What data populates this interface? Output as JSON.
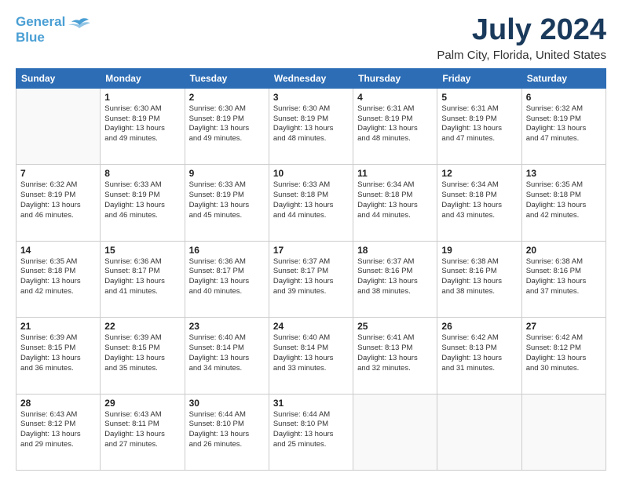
{
  "header": {
    "logo_general": "General",
    "logo_blue": "Blue",
    "main_title": "July 2024",
    "subtitle": "Palm City, Florida, United States"
  },
  "days_of_week": [
    "Sunday",
    "Monday",
    "Tuesday",
    "Wednesday",
    "Thursday",
    "Friday",
    "Saturday"
  ],
  "weeks": [
    [
      {
        "day": "",
        "sunrise": "",
        "sunset": "",
        "daylight": ""
      },
      {
        "day": "1",
        "sunrise": "6:30 AM",
        "sunset": "8:19 PM",
        "daylight": "13 hours and 49 minutes."
      },
      {
        "day": "2",
        "sunrise": "6:30 AM",
        "sunset": "8:19 PM",
        "daylight": "13 hours and 49 minutes."
      },
      {
        "day": "3",
        "sunrise": "6:30 AM",
        "sunset": "8:19 PM",
        "daylight": "13 hours and 48 minutes."
      },
      {
        "day": "4",
        "sunrise": "6:31 AM",
        "sunset": "8:19 PM",
        "daylight": "13 hours and 48 minutes."
      },
      {
        "day": "5",
        "sunrise": "6:31 AM",
        "sunset": "8:19 PM",
        "daylight": "13 hours and 47 minutes."
      },
      {
        "day": "6",
        "sunrise": "6:32 AM",
        "sunset": "8:19 PM",
        "daylight": "13 hours and 47 minutes."
      }
    ],
    [
      {
        "day": "7",
        "sunrise": "6:32 AM",
        "sunset": "8:19 PM",
        "daylight": "13 hours and 46 minutes."
      },
      {
        "day": "8",
        "sunrise": "6:33 AM",
        "sunset": "8:19 PM",
        "daylight": "13 hours and 46 minutes."
      },
      {
        "day": "9",
        "sunrise": "6:33 AM",
        "sunset": "8:19 PM",
        "daylight": "13 hours and 45 minutes."
      },
      {
        "day": "10",
        "sunrise": "6:33 AM",
        "sunset": "8:18 PM",
        "daylight": "13 hours and 44 minutes."
      },
      {
        "day": "11",
        "sunrise": "6:34 AM",
        "sunset": "8:18 PM",
        "daylight": "13 hours and 44 minutes."
      },
      {
        "day": "12",
        "sunrise": "6:34 AM",
        "sunset": "8:18 PM",
        "daylight": "13 hours and 43 minutes."
      },
      {
        "day": "13",
        "sunrise": "6:35 AM",
        "sunset": "8:18 PM",
        "daylight": "13 hours and 42 minutes."
      }
    ],
    [
      {
        "day": "14",
        "sunrise": "6:35 AM",
        "sunset": "8:18 PM",
        "daylight": "13 hours and 42 minutes."
      },
      {
        "day": "15",
        "sunrise": "6:36 AM",
        "sunset": "8:17 PM",
        "daylight": "13 hours and 41 minutes."
      },
      {
        "day": "16",
        "sunrise": "6:36 AM",
        "sunset": "8:17 PM",
        "daylight": "13 hours and 40 minutes."
      },
      {
        "day": "17",
        "sunrise": "6:37 AM",
        "sunset": "8:17 PM",
        "daylight": "13 hours and 39 minutes."
      },
      {
        "day": "18",
        "sunrise": "6:37 AM",
        "sunset": "8:16 PM",
        "daylight": "13 hours and 38 minutes."
      },
      {
        "day": "19",
        "sunrise": "6:38 AM",
        "sunset": "8:16 PM",
        "daylight": "13 hours and 38 minutes."
      },
      {
        "day": "20",
        "sunrise": "6:38 AM",
        "sunset": "8:16 PM",
        "daylight": "13 hours and 37 minutes."
      }
    ],
    [
      {
        "day": "21",
        "sunrise": "6:39 AM",
        "sunset": "8:15 PM",
        "daylight": "13 hours and 36 minutes."
      },
      {
        "day": "22",
        "sunrise": "6:39 AM",
        "sunset": "8:15 PM",
        "daylight": "13 hours and 35 minutes."
      },
      {
        "day": "23",
        "sunrise": "6:40 AM",
        "sunset": "8:14 PM",
        "daylight": "13 hours and 34 minutes."
      },
      {
        "day": "24",
        "sunrise": "6:40 AM",
        "sunset": "8:14 PM",
        "daylight": "13 hours and 33 minutes."
      },
      {
        "day": "25",
        "sunrise": "6:41 AM",
        "sunset": "8:13 PM",
        "daylight": "13 hours and 32 minutes."
      },
      {
        "day": "26",
        "sunrise": "6:42 AM",
        "sunset": "8:13 PM",
        "daylight": "13 hours and 31 minutes."
      },
      {
        "day": "27",
        "sunrise": "6:42 AM",
        "sunset": "8:12 PM",
        "daylight": "13 hours and 30 minutes."
      }
    ],
    [
      {
        "day": "28",
        "sunrise": "6:43 AM",
        "sunset": "8:12 PM",
        "daylight": "13 hours and 29 minutes."
      },
      {
        "day": "29",
        "sunrise": "6:43 AM",
        "sunset": "8:11 PM",
        "daylight": "13 hours and 27 minutes."
      },
      {
        "day": "30",
        "sunrise": "6:44 AM",
        "sunset": "8:10 PM",
        "daylight": "13 hours and 26 minutes."
      },
      {
        "day": "31",
        "sunrise": "6:44 AM",
        "sunset": "8:10 PM",
        "daylight": "13 hours and 25 minutes."
      },
      {
        "day": "",
        "sunrise": "",
        "sunset": "",
        "daylight": ""
      },
      {
        "day": "",
        "sunrise": "",
        "sunset": "",
        "daylight": ""
      },
      {
        "day": "",
        "sunrise": "",
        "sunset": "",
        "daylight": ""
      }
    ]
  ]
}
